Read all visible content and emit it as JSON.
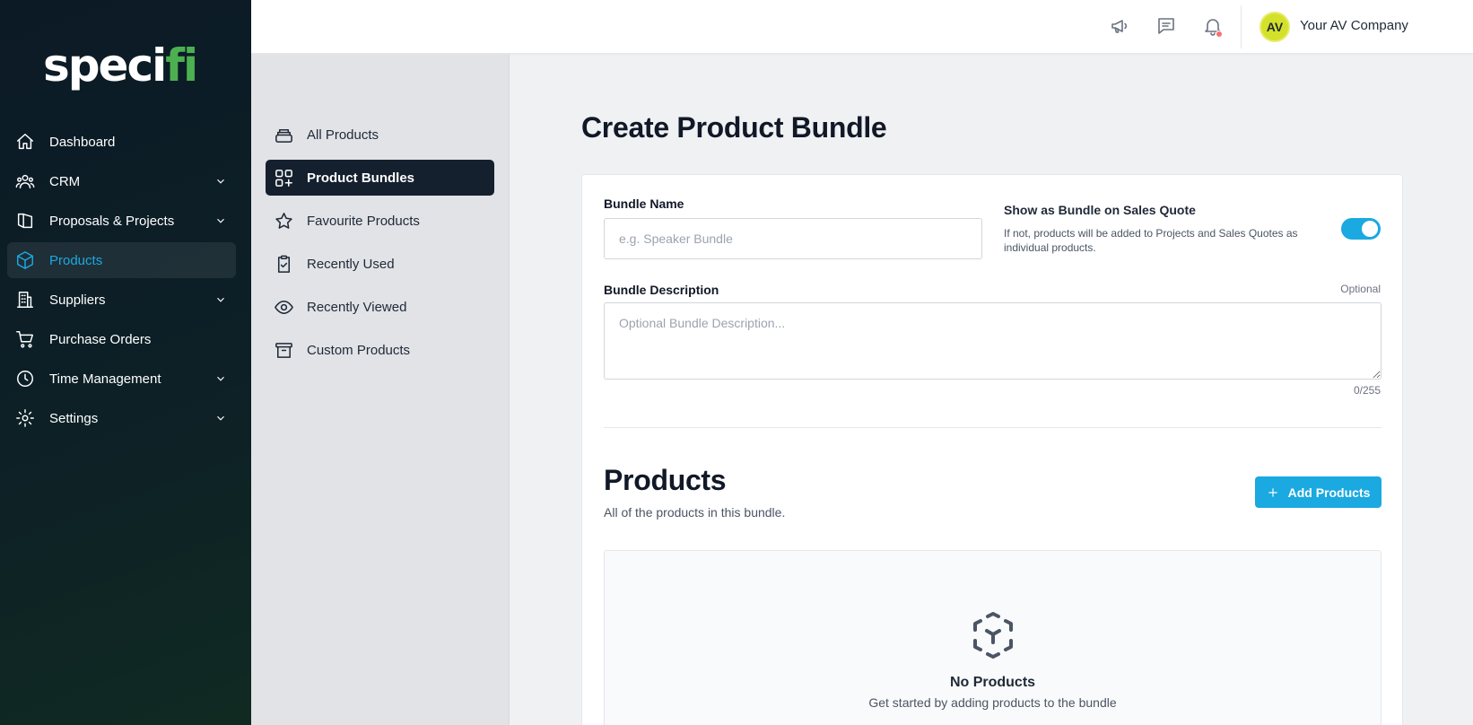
{
  "brand": {
    "logo_main": "speci",
    "logo_accent": "fi"
  },
  "sidebar": {
    "items": [
      {
        "label": "Dashboard"
      },
      {
        "label": "CRM"
      },
      {
        "label": "Proposals & Projects"
      },
      {
        "label": "Products"
      },
      {
        "label": "Suppliers"
      },
      {
        "label": "Purchase Orders"
      },
      {
        "label": "Time Management"
      },
      {
        "label": "Settings"
      }
    ]
  },
  "topbar": {
    "avatar_initials": "AV",
    "company_name": "Your AV Company"
  },
  "subnav": {
    "items": [
      {
        "label": "All Products"
      },
      {
        "label": "Product Bundles"
      },
      {
        "label": "Favourite Products"
      },
      {
        "label": "Recently Used"
      },
      {
        "label": "Recently Viewed"
      },
      {
        "label": "Custom Products"
      }
    ]
  },
  "page": {
    "title": "Create Product Bundle"
  },
  "form": {
    "bundle_name_label": "Bundle Name",
    "bundle_name_placeholder": "e.g. Speaker Bundle",
    "bundle_name_value": "",
    "show_bundle_title": "Show as Bundle on Sales Quote",
    "show_bundle_desc": "If not, products will be added to Projects and Sales Quotes as individual products.",
    "show_bundle_enabled": true,
    "description_label": "Bundle Description",
    "description_optional": "Optional",
    "description_placeholder": "Optional Bundle Description...",
    "description_counter": "0/255"
  },
  "products_section": {
    "title": "Products",
    "subtitle": "All of the products in this bundle.",
    "add_button_label": "Add Products",
    "empty_title": "No Products",
    "empty_subtitle": "Get started by adding products to the bundle"
  },
  "colors": {
    "accent": "#1aa9e0",
    "sidebar_bg": "#0c1a26",
    "active_subnav_bg": "#15202e",
    "logo_accent": "#4caf50",
    "notification_dot": "#f87171",
    "avatar_bg": "#d4e12a"
  },
  "icons": {
    "sidebar": [
      "home-icon",
      "users-icon",
      "book-icon",
      "cube-icon",
      "building-icon",
      "cart-icon",
      "clock-icon",
      "gear-icon"
    ],
    "topbar": [
      "megaphone-icon",
      "chat-icon",
      "bell-icon"
    ],
    "subnav": [
      "stack-icon",
      "squares-plus-icon",
      "star-icon",
      "clipboard-check-icon",
      "eye-icon",
      "archive-box-icon"
    ],
    "empty_state": "cube-transparent-icon"
  }
}
